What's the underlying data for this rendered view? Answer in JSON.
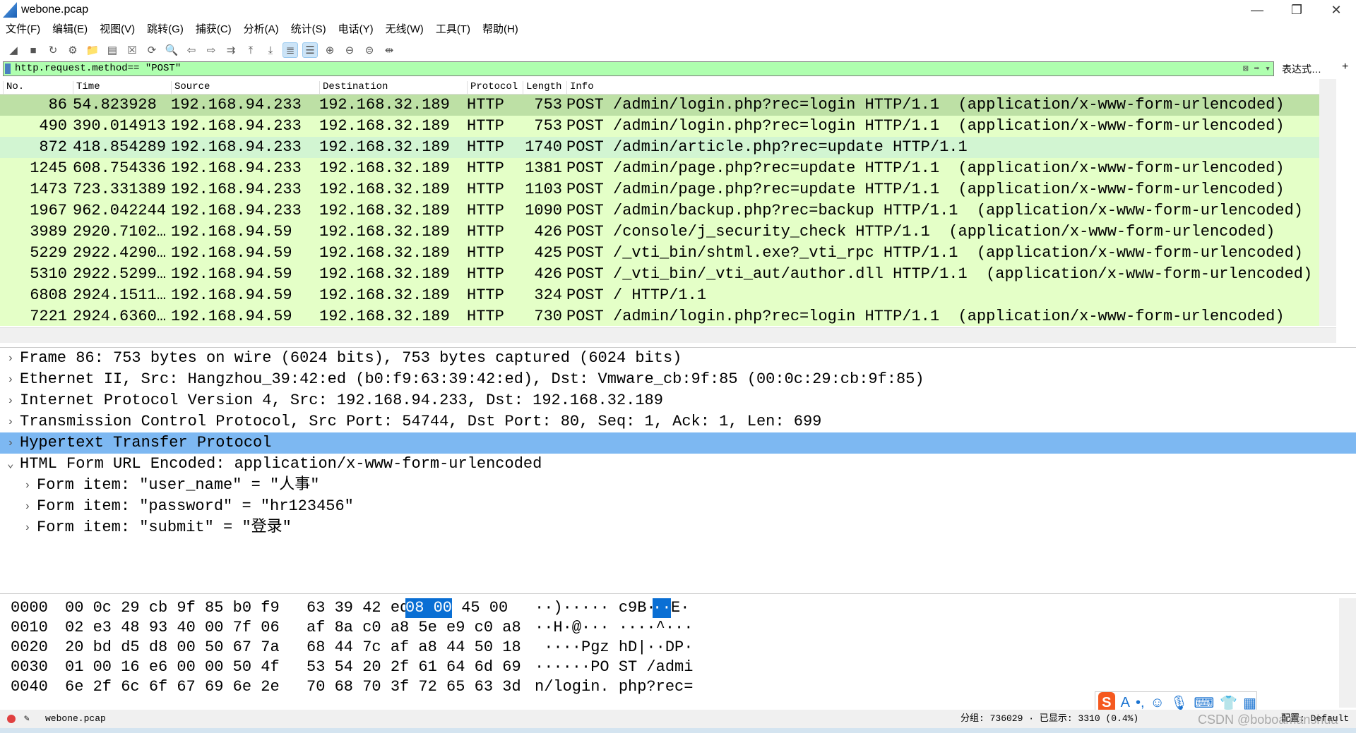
{
  "title": "webone.pcap",
  "menu": [
    "文件(F)",
    "编辑(E)",
    "视图(V)",
    "跳转(G)",
    "捕获(C)",
    "分析(A)",
    "统计(S)",
    "电话(Y)",
    "无线(W)",
    "工具(T)",
    "帮助(H)"
  ],
  "toolbar": [
    "start-capture",
    "stop-capture",
    "restart-capture",
    "capture-options",
    "open-file",
    "save-file",
    "close-file",
    "reload-file",
    "find-packet",
    "go-back",
    "go-forward",
    "go-to-packet",
    "first-packet",
    "last-packet",
    "auto-scroll",
    "colorize",
    "zoom-in",
    "zoom-out",
    "zoom-reset",
    "resize-columns"
  ],
  "filter": {
    "value": "http.request.method== \"POST\"",
    "expression_label": "表达式…",
    "add_label": "+"
  },
  "columns": [
    "No.",
    "Time",
    "Source",
    "Destination",
    "Protocol",
    "Length",
    "Info"
  ],
  "packets": [
    [
      "86",
      "54.823928",
      "192.168.94.233",
      "192.168.32.189",
      "HTTP",
      "753",
      "POST /admin/login.php?rec=login HTTP/1.1  (application/x-www-form-urlencoded)"
    ],
    [
      "490",
      "390.014913",
      "192.168.94.233",
      "192.168.32.189",
      "HTTP",
      "753",
      "POST /admin/login.php?rec=login HTTP/1.1  (application/x-www-form-urlencoded)"
    ],
    [
      "872",
      "418.854289",
      "192.168.94.233",
      "192.168.32.189",
      "HTTP",
      "1740",
      "POST /admin/article.php?rec=update HTTP/1.1"
    ],
    [
      "1245",
      "608.754336",
      "192.168.94.233",
      "192.168.32.189",
      "HTTP",
      "1381",
      "POST /admin/page.php?rec=update HTTP/1.1  (application/x-www-form-urlencoded)"
    ],
    [
      "1473",
      "723.331389",
      "192.168.94.233",
      "192.168.32.189",
      "HTTP",
      "1103",
      "POST /admin/page.php?rec=update HTTP/1.1  (application/x-www-form-urlencoded)"
    ],
    [
      "1967",
      "962.042244",
      "192.168.94.233",
      "192.168.32.189",
      "HTTP",
      "1090",
      "POST /admin/backup.php?rec=backup HTTP/1.1  (application/x-www-form-urlencoded)"
    ],
    [
      "3989",
      "2920.7102…",
      "192.168.94.59",
      "192.168.32.189",
      "HTTP",
      "426",
      "POST /console/j_security_check HTTP/1.1  (application/x-www-form-urlencoded)"
    ],
    [
      "5229",
      "2922.4290…",
      "192.168.94.59",
      "192.168.32.189",
      "HTTP",
      "425",
      "POST /_vti_bin/shtml.exe?_vti_rpc HTTP/1.1  (application/x-www-form-urlencoded)"
    ],
    [
      "5310",
      "2922.5299…",
      "192.168.94.59",
      "192.168.32.189",
      "HTTP",
      "426",
      "POST /_vti_bin/_vti_aut/author.dll HTTP/1.1  (application/x-www-form-urlencoded)"
    ],
    [
      "6808",
      "2924.1511…",
      "192.168.94.59",
      "192.168.32.189",
      "HTTP",
      "324",
      "POST / HTTP/1.1"
    ],
    [
      "7221",
      "2924.6360…",
      "192.168.94.59",
      "192.168.32.189",
      "HTTP",
      "730",
      "POST /admin/login.php?rec=login HTTP/1.1  (application/x-www-form-urlencoded)"
    ]
  ],
  "details": [
    {
      "text": "Frame 86: 753 bytes on wire (6024 bits), 753 bytes captured (6024 bits)",
      "level": 0,
      "open": false
    },
    {
      "text": "Ethernet II, Src: Hangzhou_39:42:ed (b0:f9:63:39:42:ed), Dst: Vmware_cb:9f:85 (00:0c:29:cb:9f:85)",
      "level": 0,
      "open": false
    },
    {
      "text": "Internet Protocol Version 4, Src: 192.168.94.233, Dst: 192.168.32.189",
      "level": 0,
      "open": false
    },
    {
      "text": "Transmission Control Protocol, Src Port: 54744, Dst Port: 80, Seq: 1, Ack: 1, Len: 699",
      "level": 0,
      "open": false
    },
    {
      "text": "Hypertext Transfer Protocol",
      "level": 0,
      "open": false
    },
    {
      "text": "HTML Form URL Encoded: application/x-www-form-urlencoded",
      "level": 0,
      "open": true
    },
    {
      "text": "Form item: \"user_name\" = \"人事\"",
      "level": 1,
      "open": false
    },
    {
      "text": "Form item: \"password\" = \"hr123456\"",
      "level": 1,
      "open": false
    },
    {
      "text": "Form item: \"submit\" = \"登录\"",
      "level": 1,
      "open": false
    }
  ],
  "hex": [
    {
      "off": "0000",
      "a": "00 0c 29 cb 9f 85 b0 f9",
      "b1": "63 39 42 ed ",
      "hl": "08 00",
      "b2": " 45 00",
      "asc1": "··)····· c9B·",
      "asch": "··",
      "asc2": "E·"
    },
    {
      "off": "0010",
      "a": "02 e3 48 93 40 00 7f 06",
      "b1": "af 8a c0 a8 5e e9 c0 a8",
      "hl": "",
      "b2": "",
      "asc1": "··H·@··· ····^···",
      "asch": "",
      "asc2": ""
    },
    {
      "off": "0020",
      "a": "20 bd d5 d8 00 50 67 7a",
      "b1": "68 44 7c af a8 44 50 18",
      "hl": "",
      "b2": "",
      "asc1": " ····Pgz hD|··DP·",
      "asch": "",
      "asc2": ""
    },
    {
      "off": "0030",
      "a": "01 00 16 e6 00 00 50 4f",
      "b1": "53 54 20 2f 61 64 6d 69",
      "hl": "",
      "b2": "",
      "asc1": "······PO ST /admi",
      "asch": "",
      "asc2": ""
    },
    {
      "off": "0040",
      "a": "6e 2f 6c 6f 67 69 6e 2e",
      "b1": "70 68 70 3f 72 65 63 3d",
      "hl": "",
      "b2": "",
      "asc1": "n/login. php?rec=",
      "asch": "",
      "asc2": ""
    }
  ],
  "status": {
    "file": "webone.pcap",
    "packets": "分组: 736029 · 已显示: 3310 (0.4%)",
    "profile": "配置: Default"
  },
  "watermark": "CSDN @boboamanshua",
  "colors": {
    "row": "#e4ffc7",
    "selected_row": "#bde0a5",
    "detail_selected": "#7db8f2",
    "filter_ok": "#afffaf",
    "hex_highlight": "#0a6fd4"
  }
}
